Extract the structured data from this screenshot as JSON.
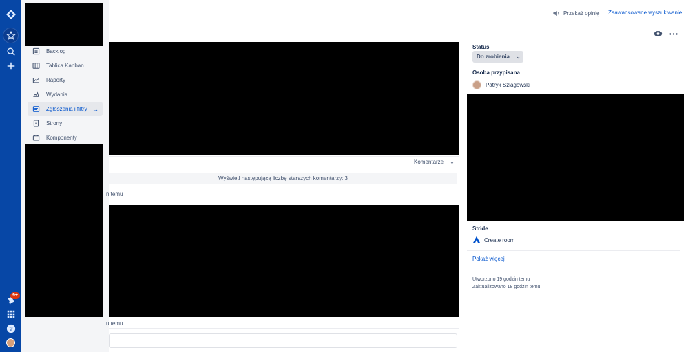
{
  "top": {
    "feedback_label": "Przekaż opinię",
    "advanced_search_label": "Zaawansowane wyszukiwanie"
  },
  "global_nav": {
    "notifications_badge": "9+"
  },
  "project_nav": {
    "items": [
      {
        "label": "Backlog",
        "icon": "backlog-icon"
      },
      {
        "label": "Tablica Kanban",
        "icon": "board-icon"
      },
      {
        "label": "Raporty",
        "icon": "reports-icon"
      },
      {
        "label": "Wydania",
        "icon": "releases-icon"
      },
      {
        "label": "Zgłoszenia i filtry",
        "icon": "issues-icon",
        "active": true
      },
      {
        "label": "Strony",
        "icon": "pages-icon"
      },
      {
        "label": "Komponenty",
        "icon": "components-icon"
      }
    ]
  },
  "activity": {
    "comments_label": "Komentarze",
    "older_comments_text": "Wyświetl następującą liczbę starszych komentarzy: 3",
    "fragment_1": "n temu",
    "fragment_2": "u temu"
  },
  "sidebar": {
    "status_heading": "Status",
    "status_value": "Do zrobienia",
    "assignee_heading": "Osoba przypisana",
    "assignee_name": "Patryk Szlagowski",
    "stride_heading": "Stride",
    "create_room_label": "Create room",
    "show_more_label": "Pokaż więcej",
    "created_text": "Utworzono 19 godzin temu",
    "updated_text": "Zaktualizowano 18 godzin temu"
  },
  "colors": {
    "nav_blue": "#0747a6",
    "link_blue": "#0052cc",
    "badge_red": "#de350b"
  }
}
